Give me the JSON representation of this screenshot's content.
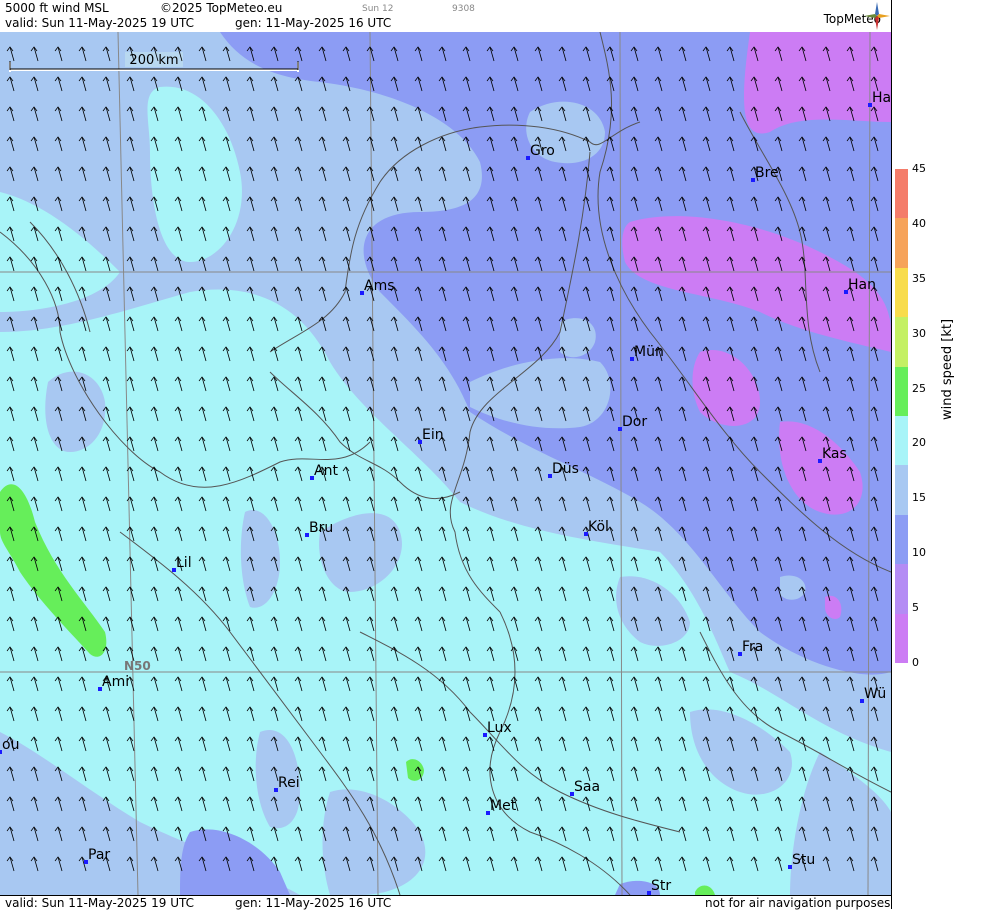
{
  "header": {
    "product": "5000 ft wind MSL",
    "copyright": "©2025 TopMeteo.eu",
    "valid": "valid:  Sun  11-May-2025  19 UTC",
    "gen": "gen: 11-May-2025 16 UTC",
    "day_small": "Sun 12",
    "code_small": "9308",
    "brand": "TopMeteo"
  },
  "footer": {
    "valid": "valid:  Sun  11-May-2025  19 UTC",
    "gen": "gen: 11-May-2025 16 UTC",
    "disclaimer": "not for air navigation purposes"
  },
  "map": {
    "scale_label": "200 km",
    "lat_label": "N50",
    "cities": [
      {
        "name": "Gro"
      },
      {
        "name": "Bre"
      },
      {
        "name": "Ha"
      },
      {
        "name": "Ams"
      },
      {
        "name": "Han"
      },
      {
        "name": "Mün"
      },
      {
        "name": "Ein"
      },
      {
        "name": "Dor"
      },
      {
        "name": "Kas"
      },
      {
        "name": "Ant"
      },
      {
        "name": "Düs"
      },
      {
        "name": "Bru"
      },
      {
        "name": "Köl"
      },
      {
        "name": "Lil"
      },
      {
        "name": "Fra"
      },
      {
        "name": "Ami"
      },
      {
        "name": "Wü"
      },
      {
        "name": "Lux"
      },
      {
        "name": "ou"
      },
      {
        "name": "Rei"
      },
      {
        "name": "Saa"
      },
      {
        "name": "Met"
      },
      {
        "name": "Par"
      },
      {
        "name": "Stu"
      },
      {
        "name": "Str"
      }
    ]
  },
  "legend": {
    "title": "wind speed [kt]",
    "ticks": [
      "45",
      "40",
      "35",
      "30",
      "25",
      "20",
      "15",
      "10",
      "5",
      "0"
    ],
    "colors": [
      "#f47c6a",
      "#f6a35a",
      "#f8dc4c",
      "#c4f064",
      "#66ee5a",
      "#a8f4f8",
      "#a8c8f2",
      "#8c9cf4",
      "#b48cf4",
      "#cc7cf4"
    ]
  }
}
